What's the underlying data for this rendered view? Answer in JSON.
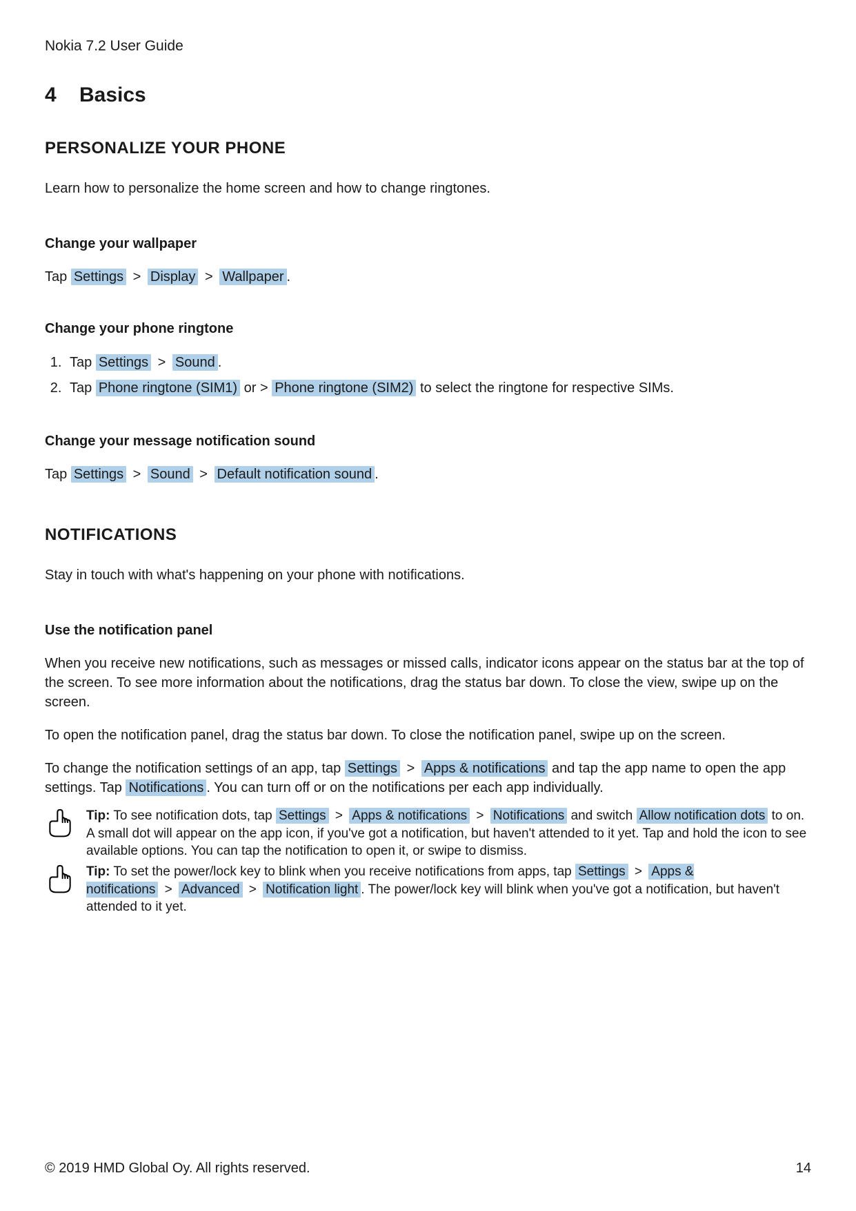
{
  "docTitle": "Nokia 7.2 User Guide",
  "chapter": {
    "number": "4",
    "title": "Basics"
  },
  "sections": {
    "personalize": {
      "heading": "PERSONALIZE YOUR PHONE",
      "intro": "Learn how to personalize the home screen and how to change ringtones.",
      "wallpaper": {
        "heading": "Change your wallpaper",
        "prefix": "Tap ",
        "path": [
          "Settings",
          "Display",
          "Wallpaper"
        ],
        "suffix": "."
      },
      "ringtone": {
        "heading": "Change your phone ringtone",
        "step1_prefix": "Tap ",
        "step1_path": [
          "Settings",
          "Sound"
        ],
        "step1_suffix": ".",
        "step2_prefix": "Tap ",
        "step2_a": "Phone ringtone (SIM1)",
        "step2_mid": " or > ",
        "step2_b": "Phone ringtone (SIM2)",
        "step2_suffix": " to select the ringtone for respective SIMs."
      },
      "message": {
        "heading": "Change your message notification sound",
        "prefix": "Tap ",
        "path": [
          "Settings",
          "Sound",
          "Default notification sound"
        ],
        "suffix": "."
      }
    },
    "notifications": {
      "heading": "NOTIFICATIONS",
      "intro": "Stay in touch with what's happening on your phone with notifications.",
      "panel": {
        "heading": "Use the notification panel",
        "p1": "When you receive new notifications, such as messages or missed calls, indicator icons appear on the status bar at the top of the screen. To see more information about the notifications, drag the status bar down. To close the view, swipe up on the screen.",
        "p2": "To open the notification panel, drag the status bar down. To close the notification panel, swipe up on the screen.",
        "p3_a": "To change the notification settings of an app, tap ",
        "p3_path1": [
          "Settings",
          "Apps & notifications"
        ],
        "p3_b": " and tap the app name to open the app settings. Tap ",
        "p3_notif": "Notifications",
        "p3_c": ". You can turn off or on the notifications per each app individually."
      },
      "tip1": {
        "label": "Tip:",
        "a": " To see notification dots, tap ",
        "path": [
          "Settings",
          "Apps & notifications",
          "Notifications"
        ],
        "b": " and switch ",
        "switch": "Allow notification dots",
        "c": " to on. A small dot will appear on the app icon, if you've got a notification, but haven't attended to it yet. Tap and hold the icon to see available options. You can tap the notification to open it, or swipe to dismiss."
      },
      "tip2": {
        "label": "Tip:",
        "a": " To set the power/lock key to blink when you receive notifications from apps, tap ",
        "path": [
          "Settings",
          "Apps & notifications",
          "Advanced",
          "Notification light"
        ],
        "b": ". The power/lock key will blink when you've got a notification, but haven't attended to it yet."
      }
    }
  },
  "footer": {
    "copyright": "© 2019 HMD Global Oy. All rights reserved.",
    "page": "14"
  },
  "sep": " > "
}
